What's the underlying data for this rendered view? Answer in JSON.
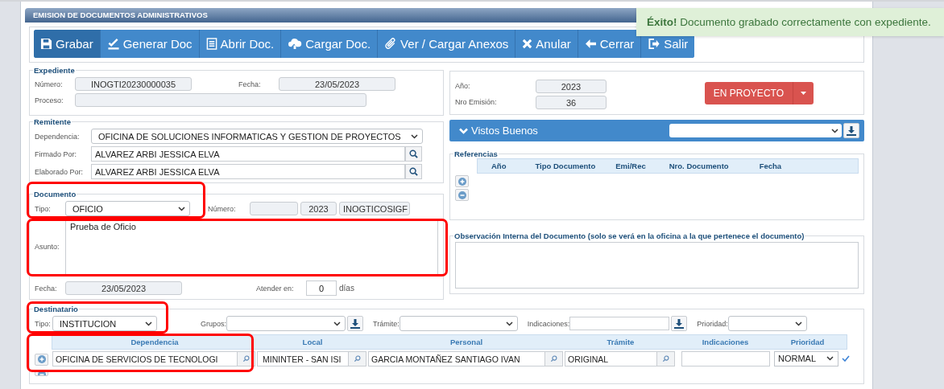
{
  "window": {
    "title": "EMISION DE DOCUMENTOS ADMINISTRATIVOS"
  },
  "toast": {
    "message": "**Éxito!** Documento grabado correctamente con expediente."
  },
  "toolbar": [
    {
      "label": "Grabar",
      "selected": true
    },
    {
      "label": "Generar Doc",
      "selected": false
    },
    {
      "label": "Abrir Doc.",
      "selected": false
    },
    {
      "label": "Cargar Doc.",
      "selected": false
    },
    {
      "label": "Ver / Cargar Anexos",
      "selected": false
    },
    {
      "label": "Anular",
      "selected": false
    },
    {
      "label": "Cerrar",
      "selected": false
    },
    {
      "label": "Salir",
      "selected": false
    }
  ],
  "expediente": {
    "legend": "Expediente",
    "numero_label": "Número:",
    "numero": "INOGTI20230000035",
    "fecha_label": "Fecha:",
    "fecha": "23/05/2023",
    "proceso_label": "Proceso:"
  },
  "emision": {
    "anio_label": "Año:",
    "anio": "2023",
    "nro_label": "Nro Emisión:",
    "nro": "36",
    "status": "EN PROYECTO"
  },
  "remitente": {
    "legend": "Remitente",
    "dependencia_label": "Dependencia:",
    "dependencia": "OFICINA DE SOLUCIONES INFORMATICAS Y GESTION DE PROYECTOS",
    "firmado_label": "Firmado Por:",
    "firmado": "ALVAREZ ARBI JESSICA ELVA",
    "elaborado_label": "Elaborado Por:",
    "elaborado": "ALVAREZ ARBI JESSICA ELVA"
  },
  "vistos_buenos": {
    "title": "Vistos Buenos"
  },
  "referencias": {
    "legend": "Referencias",
    "columns": [
      "Año",
      "Tipo Documento",
      "Emi/Rec",
      "Nro. Documento",
      "Fecha"
    ]
  },
  "documento": {
    "legend": "Documento",
    "tipo_label": "Tipo:",
    "tipo": "OFICIO",
    "numero_label": "Número:",
    "numero_anio": "2023",
    "numero_sigla": "INOGTICOSIGF",
    "asunto_label": "Asunto:",
    "asunto": "Prueba de Oficio",
    "fecha_label": "Fecha:",
    "fecha": "23/05/2023",
    "atender_label": "Atender en:",
    "atender": "0",
    "dias": "días"
  },
  "observacion": {
    "legend": "Observación Interna del Documento (solo se verá en la oficina a la que pertenece el documento)"
  },
  "destinatario": {
    "legend": "Destinatario",
    "tipo_label": "Tipo:",
    "tipo": "INSTITUCION",
    "grupos_label": "Grupos:",
    "tramite_label": "Trámite:",
    "indicaciones_label": "Indicaciones:",
    "prioridad_label": "Prioridad:",
    "columns": [
      "Dependencia",
      "Local",
      "Personal",
      "Trámite",
      "Indicaciones",
      "Prioridad"
    ],
    "rows": [
      {
        "dependencia": "OFICINA DE SERVICIOS DE TECNOLOGI",
        "local": "MININTER - SAN ISI",
        "personal": "GARCIA MONTAÑEZ SANTIAGO IVAN",
        "tramite": "ORIGINAL",
        "prioridad": "NORMAL"
      }
    ]
  }
}
